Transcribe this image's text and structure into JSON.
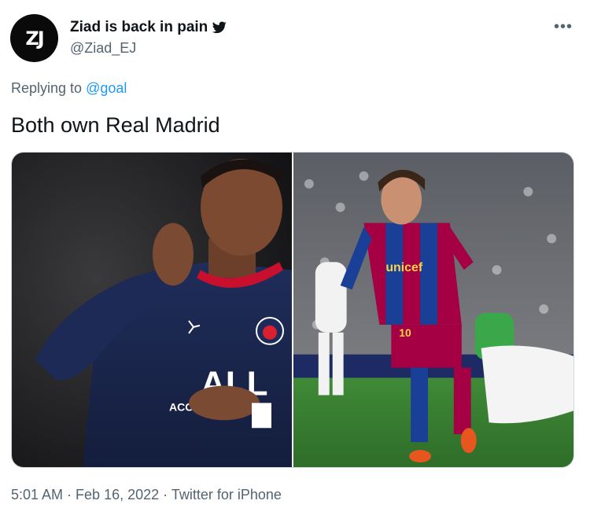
{
  "author": {
    "display_name": "Ziad is back in pain",
    "handle": "@Ziad_EJ",
    "avatar_text": "ZJ",
    "avatar_icon": "avatar-logo",
    "bird_icon": "twitter-bird-icon"
  },
  "reply": {
    "prefix": "Replying to",
    "mention": "@goal"
  },
  "tweet": {
    "text": "Both own Real Madrid"
  },
  "media": {
    "left_photo": "photo-mbappe-psg",
    "right_photo": "photo-messi-barcelona",
    "left_jersey_text": "ALL",
    "left_sponsor_text": "ACC",
    "left_badge_text": "PARIS",
    "right_sponsor_text": "unicef",
    "right_number": "10"
  },
  "meta": {
    "time": "5:01 AM",
    "date": "Feb 16, 2022",
    "source": "Twitter for iPhone",
    "separator": " · "
  },
  "colors": {
    "accent_blue": "#1d9bf0",
    "secondary_text": "#536471",
    "primary_text": "#0f1419"
  }
}
